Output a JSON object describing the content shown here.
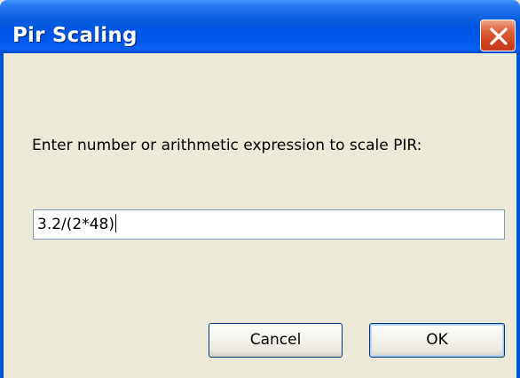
{
  "dialog": {
    "title": "Pir Scaling",
    "prompt": "Enter number or arithmetic expression to scale PIR:",
    "input_value": "3.2/(2*48)",
    "buttons": {
      "cancel": "Cancel",
      "ok": "OK"
    },
    "icons": {
      "close": "close-icon"
    },
    "colors": {
      "titlebar": "#0055e5",
      "close_button": "#d04520",
      "window_bg": "#ece9d8"
    }
  }
}
